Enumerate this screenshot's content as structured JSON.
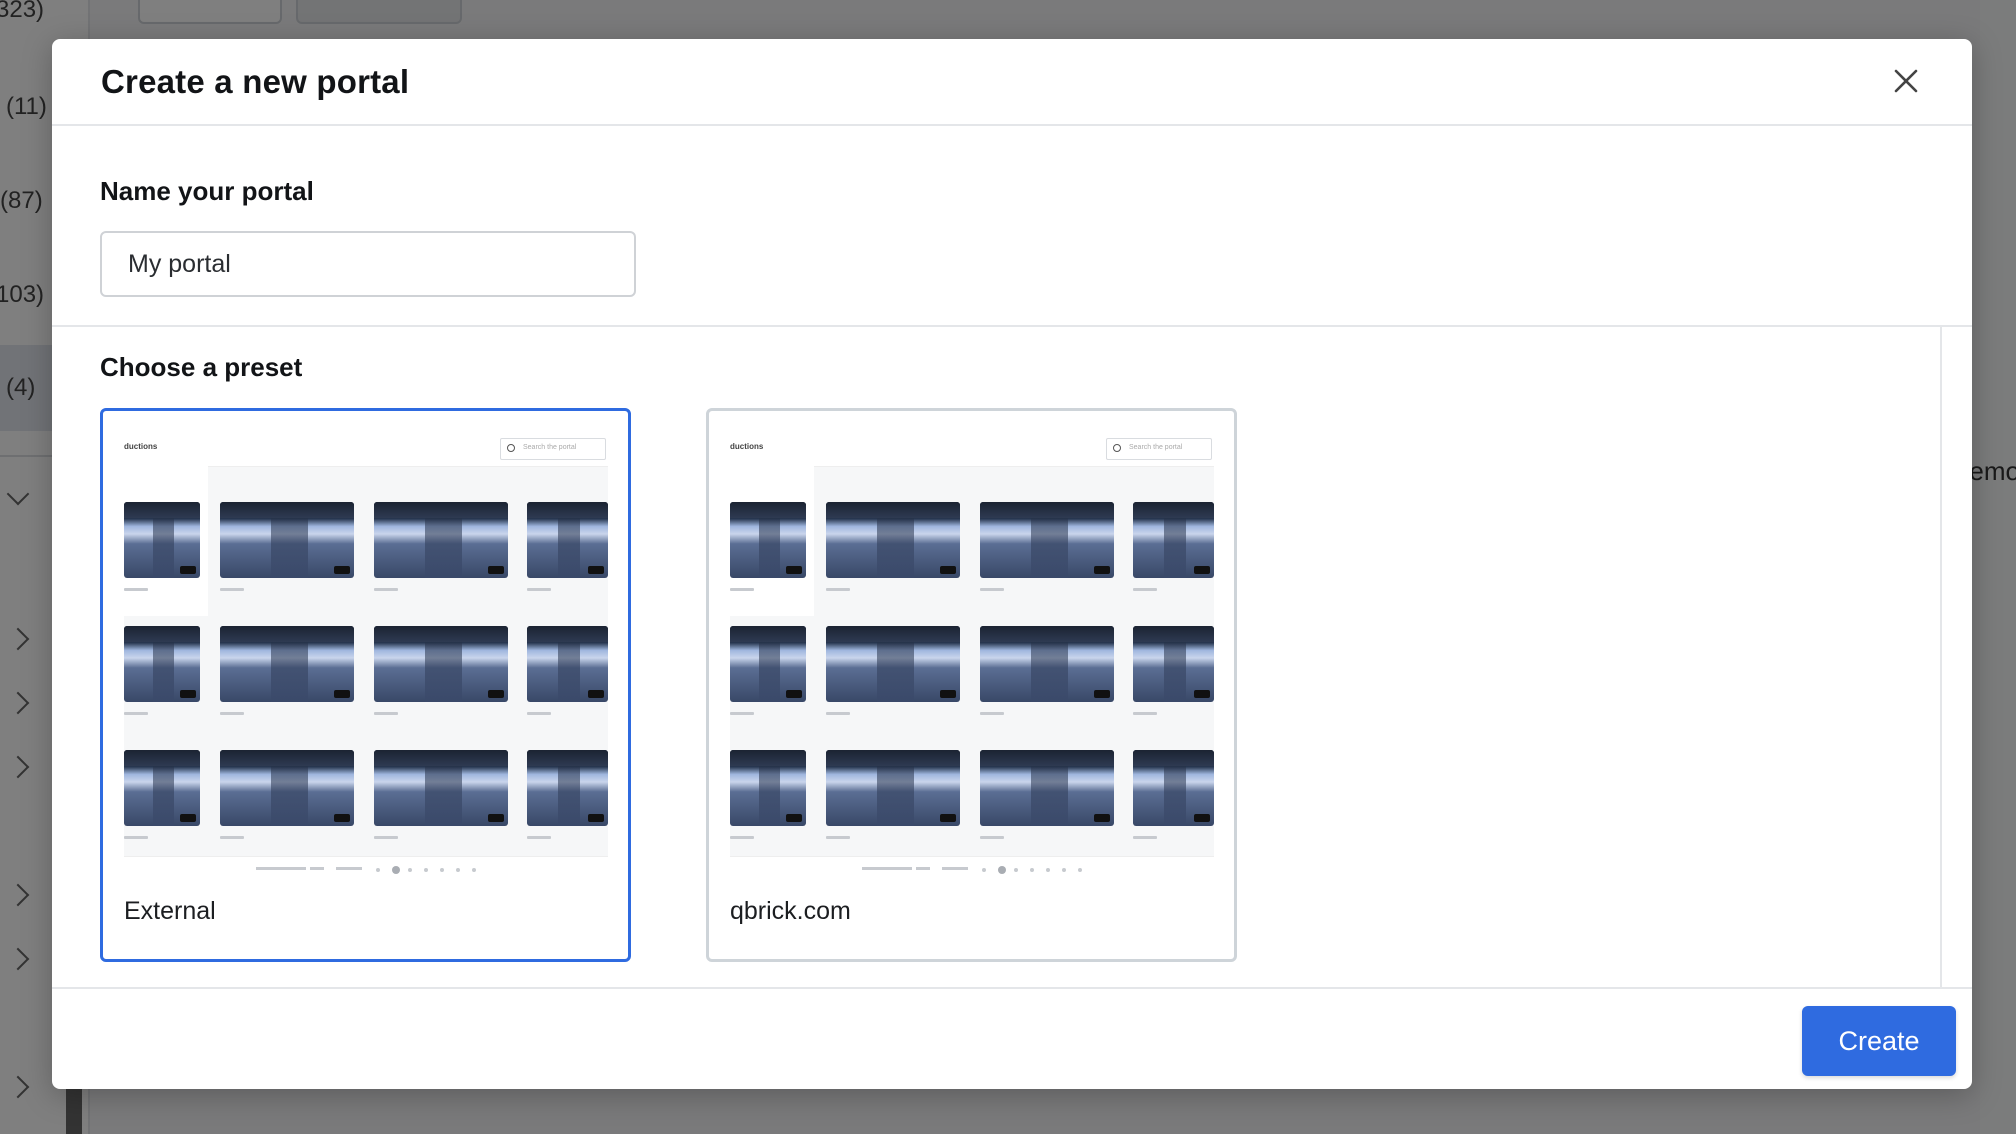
{
  "background": {
    "sidebar_counts": [
      "323)",
      "(11)",
      "(87)",
      "103)",
      "(4)"
    ],
    "right_text": "emo"
  },
  "modal": {
    "title": "Create a new portal",
    "name_label": "Name your portal",
    "name_value": "My portal",
    "preset_label": "Choose a preset",
    "presets": [
      {
        "name": "External",
        "selected": true,
        "preview_brand": "ductions",
        "preview_search": "Search the portal"
      },
      {
        "name": "qbrick.com",
        "selected": false,
        "preview_brand": "ductions",
        "preview_search": "Search the portal"
      }
    ],
    "create_label": "Create"
  },
  "colors": {
    "accent": "#2f6be0",
    "overlay": "rgba(0,0,0,0.5)",
    "card_border": "#ced4d9"
  },
  "icons": {
    "close": "close-icon",
    "search": "search-icon",
    "chevron": "chevron-icon"
  }
}
